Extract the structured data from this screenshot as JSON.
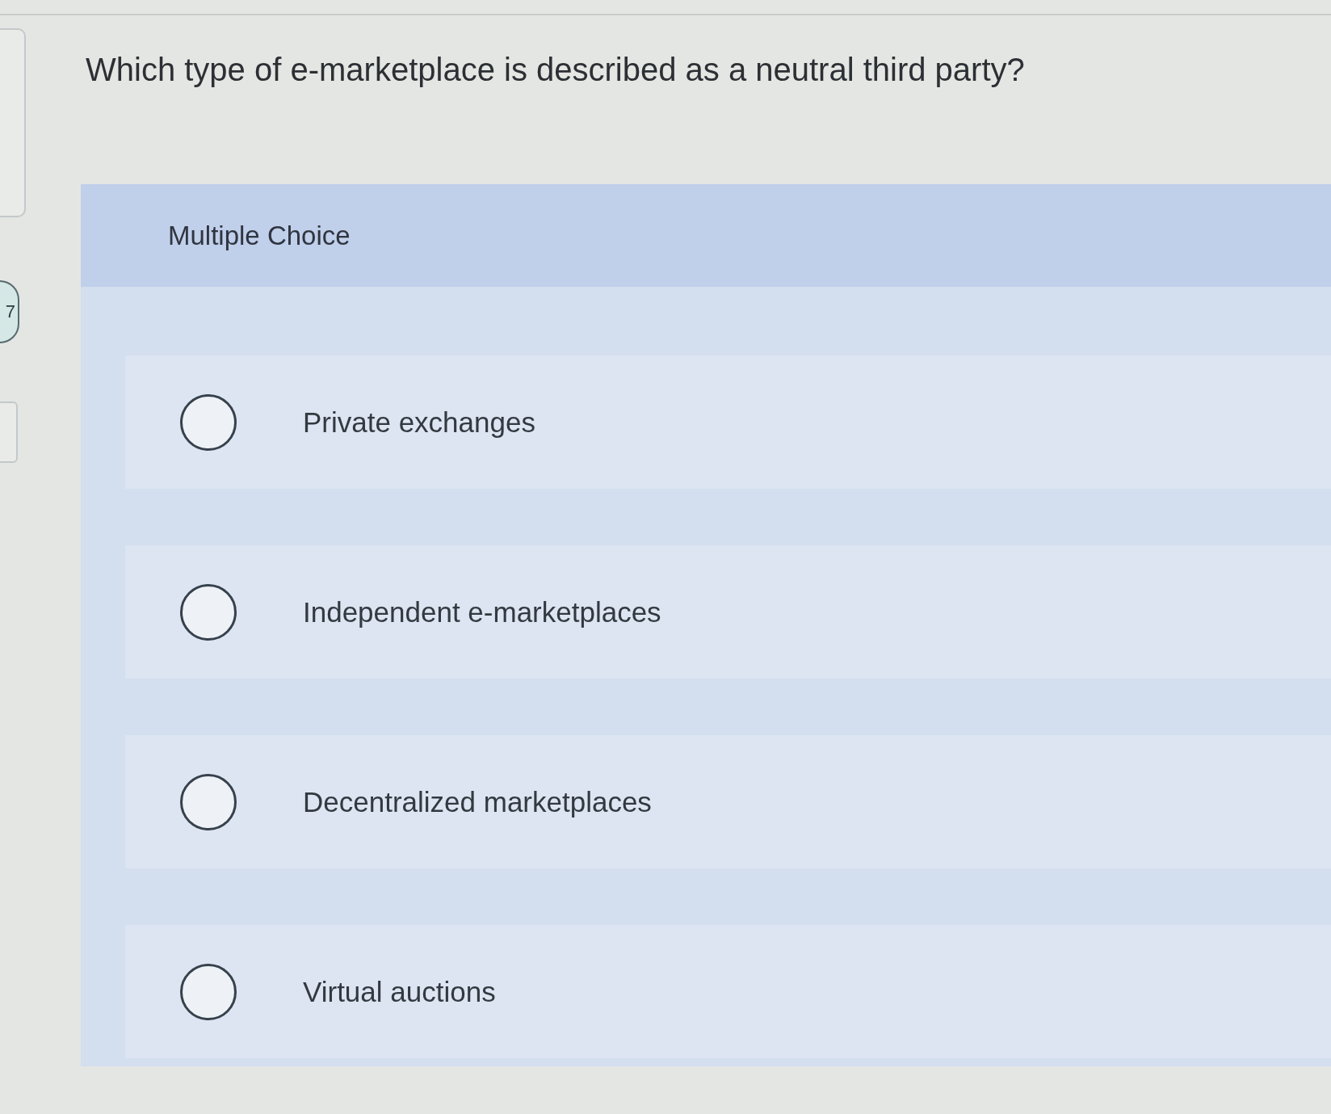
{
  "question": {
    "number": "7",
    "text": "Which type of e-marketplace is described as a neutral third party?"
  },
  "answer_panel": {
    "label": "Multiple Choice",
    "options": [
      {
        "label": "Private exchanges",
        "selected": false
      },
      {
        "label": "Independent e-marketplaces",
        "selected": false
      },
      {
        "label": "Decentralized marketplaces",
        "selected": false
      },
      {
        "label": "Virtual auctions",
        "selected": false
      }
    ]
  }
}
